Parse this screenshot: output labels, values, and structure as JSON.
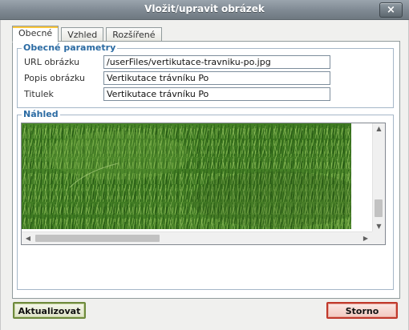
{
  "dialog": {
    "title": "Vložit/upravit obrázek",
    "close_label": "×"
  },
  "tabs": [
    {
      "label": "Obecné",
      "active": true
    },
    {
      "label": "Vzhled",
      "active": false
    },
    {
      "label": "Rozšířené",
      "active": false
    }
  ],
  "general": {
    "legend": "Obecné parametry",
    "fields": [
      {
        "label": "URL obrázku",
        "value": "/userFiles/vertikutace-travniku-po.jpg"
      },
      {
        "label": "Popis obrázku",
        "value": "Vertikutace trávníku Po"
      },
      {
        "label": "Titulek",
        "value": "Vertikutace trávníku Po"
      }
    ]
  },
  "preview": {
    "legend": "Náhled",
    "image": "grass-lawn-photo"
  },
  "scrollbars": {
    "up_arrow": "▲",
    "down_arrow": "▼",
    "left_arrow": "◀",
    "right_arrow": "▶",
    "vertical_position": 0.78,
    "horizontal_position": 0.0
  },
  "buttons": {
    "update": "Aktualizovat",
    "cancel": "Storno"
  },
  "colors": {
    "titlebar": "#7f8992",
    "legend": "#2b6ba3",
    "grass_dark": "#2f6a1a",
    "grass_light": "#5e9a35",
    "update_border": "#6e8a3c",
    "cancel_border": "#c0392b"
  }
}
